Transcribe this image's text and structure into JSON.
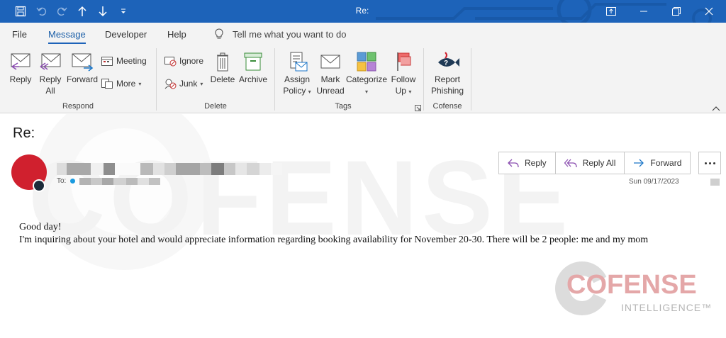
{
  "window": {
    "title": "Re:"
  },
  "menu": {
    "tabs": [
      "File",
      "Message",
      "Developer",
      "Help"
    ],
    "active_tab": "Message",
    "tell_me": "Tell me what you want to do"
  },
  "ribbon": {
    "respond": {
      "label": "Respond",
      "reply": "Reply",
      "reply_all": [
        "Reply",
        "All"
      ],
      "forward": "Forward",
      "meeting": "Meeting",
      "more": "More"
    },
    "delete": {
      "label": "Delete",
      "ignore": "Ignore",
      "junk": "Junk",
      "delete": "Delete",
      "archive": "Archive"
    },
    "tags": {
      "label": "Tags",
      "assign_policy": [
        "Assign",
        "Policy"
      ],
      "mark_unread": [
        "Mark",
        "Unread"
      ],
      "categorize": "Categorize",
      "follow_up": [
        "Follow",
        "Up"
      ]
    },
    "cofense": {
      "label": "Cofense",
      "report_phishing": [
        "Report",
        "Phishing"
      ]
    }
  },
  "message": {
    "subject": "Re:",
    "to_label": "To:",
    "date": "Sun 09/17/2023",
    "actions": {
      "reply": "Reply",
      "reply_all": "Reply All",
      "forward": "Forward"
    },
    "body": [
      "Good day!",
      "I'm inquiring about your hotel and would appreciate information regarding booking availability for November 20-30. There will be 2 people: me and my mom"
    ]
  },
  "watermark": {
    "brand": "COFENSE",
    "logo_word": "COFENSE",
    "logo_sub": "INTELLIGENCE™"
  },
  "colors": {
    "title_bar": "#1d63b9",
    "avatar": "#d0202e",
    "accent": "#1b5fa8"
  }
}
